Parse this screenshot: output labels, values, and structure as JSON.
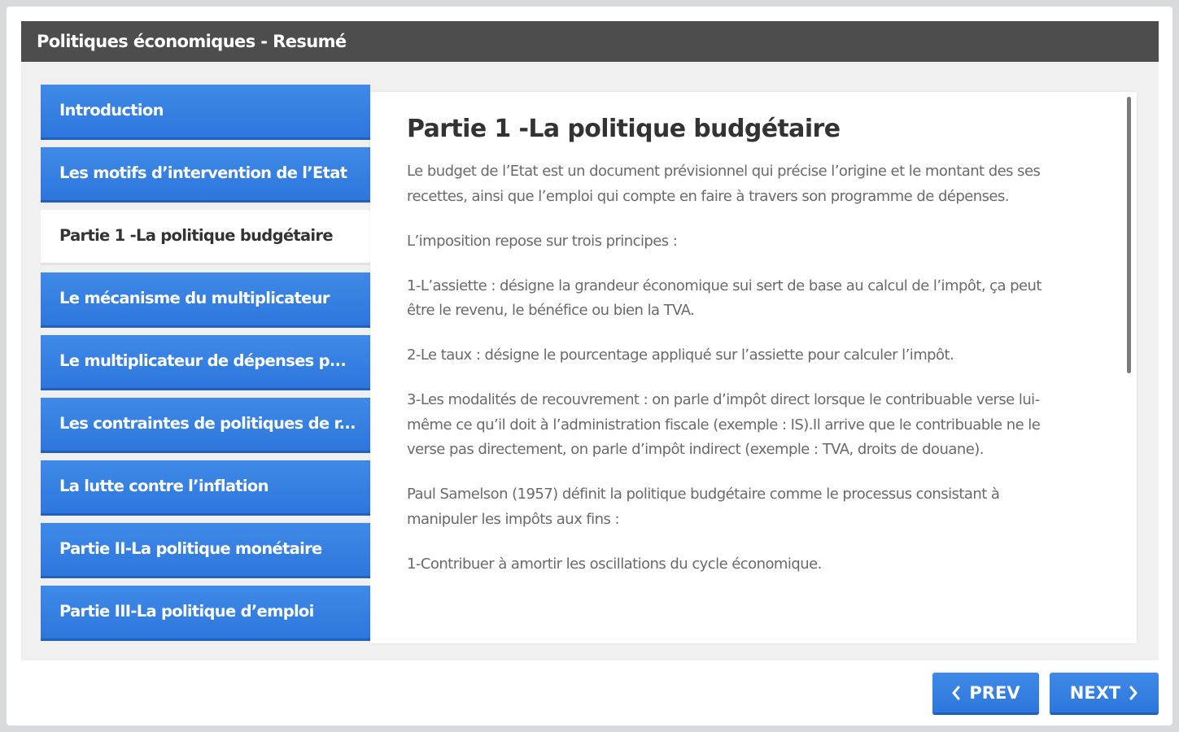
{
  "window": {
    "title": "Politiques économiques - Resumé"
  },
  "nav": {
    "items": [
      {
        "label": "Introduction",
        "active": false
      },
      {
        "label": "Les motifs d’intervention de l’Etat",
        "active": false
      },
      {
        "label": "Partie 1 -La politique budgétaire",
        "active": true
      },
      {
        "label": "Le mécanisme du multiplicateur",
        "active": false
      },
      {
        "label": "Le multiplicateur de dépenses p...",
        "active": false
      },
      {
        "label": "Les contraintes de politiques de r...",
        "active": false
      },
      {
        "label": "La lutte contre l’inflation",
        "active": false
      },
      {
        "label": "Partie II-La politique monétaire",
        "active": false
      },
      {
        "label": "Partie III-La politique d’emploi",
        "active": false
      }
    ]
  },
  "content": {
    "heading": "Partie 1 -La politique budgétaire",
    "paragraphs": [
      "Le budget de l’Etat est un document prévisionnel qui précise l’origine et le montant des ses recettes, ainsi que l’emploi qui compte en faire à travers son programme de dépenses.",
      "L’imposition repose sur trois principes :",
      "1-L’assiette : désigne la grandeur économique sui sert de base au calcul de l’impôt, ça peut être le revenu, le bénéfice ou bien la TVA.",
      "2-Le taux : désigne le pourcentage appliqué sur l’assiette pour calculer l’impôt.",
      "3-Les modalités de recouvrement : on parle d’impôt direct lorsque le contribuable verse lui- même ce qu’il doit à l’administration fiscale (exemple : IS).Il arrive que le contribuable ne le verse pas directement, on parle d’impôt indirect (exemple : TVA, droits de douane).",
      "Paul Samelson (1957) définit la politique budgétaire comme le processus consistant à manipuler les impôts aux fins :",
      "1-Contribuer à amortir les oscillations du cycle économique."
    ]
  },
  "footer": {
    "prev_label": "PREV",
    "next_label": "NEXT"
  },
  "colors": {
    "accent": "#2e76dc",
    "titlebar": "#4d4d4d",
    "body_text": "#6a6a6a"
  },
  "icons": {
    "prev": "chevron-left-icon",
    "next": "chevron-right-icon"
  }
}
